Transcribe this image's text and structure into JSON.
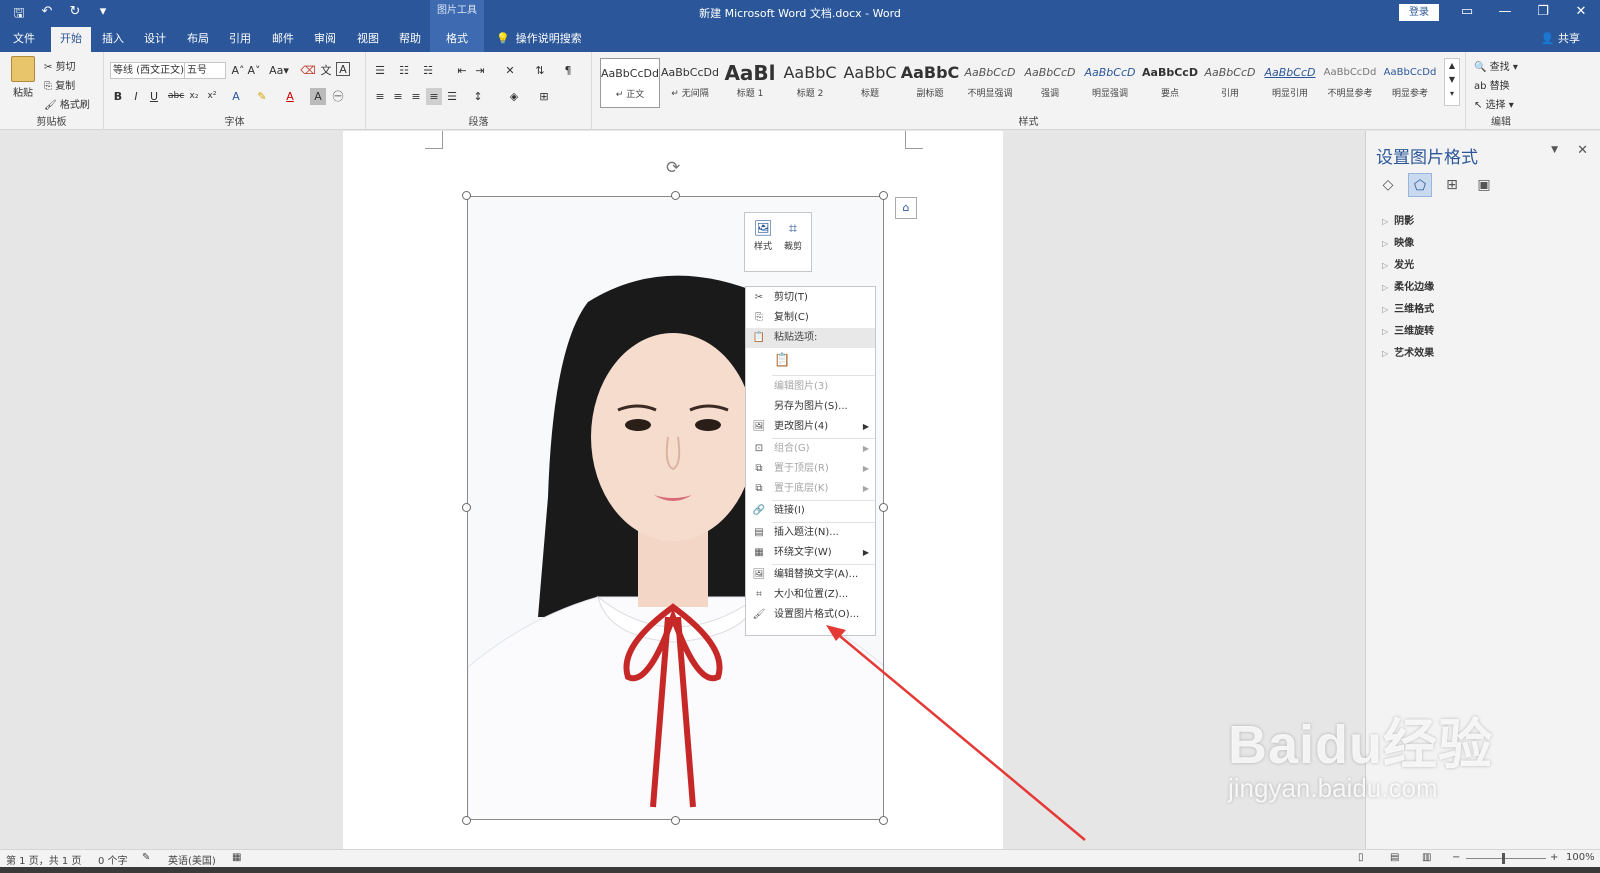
{
  "titlebar": {
    "context_tools": "图片工具",
    "document_title": "新建 Microsoft Word 文档.docx  -  Word",
    "login_label": "登录"
  },
  "tabs": {
    "file": "文件",
    "home": "开始",
    "insert": "插入",
    "design": "设计",
    "layout": "布局",
    "references": "引用",
    "mailings": "邮件",
    "review": "审阅",
    "view": "视图",
    "help": "帮助",
    "format": "格式",
    "tell_me": "操作说明搜索",
    "share": "共享"
  },
  "ribbon": {
    "clipboard": {
      "label": "剪贴板",
      "paste": "粘贴",
      "cut": "剪切",
      "copy": "复制",
      "format_painter": "格式刷"
    },
    "font": {
      "label": "字体",
      "font_name": "等线 (西文正文)",
      "font_size": "五号"
    },
    "paragraph": {
      "label": "段落"
    },
    "styles": {
      "label": "样式",
      "items": [
        {
          "preview": "AaBbCcDd",
          "name": "↵ 正文"
        },
        {
          "preview": "AaBbCcDd",
          "name": "↵ 无间隔"
        },
        {
          "preview": "AaBl",
          "name": "标题 1"
        },
        {
          "preview": "AaBbC",
          "name": "标题 2"
        },
        {
          "preview": "AaBbC",
          "name": "标题"
        },
        {
          "preview": "AaBbC",
          "name": "副标题"
        },
        {
          "preview": "AaBbCcD",
          "name": "不明显强调"
        },
        {
          "preview": "AaBbCcD",
          "name": "强调"
        },
        {
          "preview": "AaBbCcD",
          "name": "明显强调"
        },
        {
          "preview": "AaBbCcD",
          "name": "要点"
        },
        {
          "preview": "AaBbCcD",
          "name": "引用"
        },
        {
          "preview": "AaBbCcD",
          "name": "明显引用"
        },
        {
          "preview": "AaBbCcDd",
          "name": "不明显参考"
        },
        {
          "preview": "AaBbCcDd",
          "name": "明显参考"
        }
      ]
    },
    "editing": {
      "label": "编辑",
      "find": "查找",
      "replace": "替换",
      "select": "选择"
    }
  },
  "mini_toolbar": {
    "style": "样式",
    "crop": "裁剪"
  },
  "context_menu": {
    "cut": "剪切(T)",
    "copy": "复制(C)",
    "paste_options": "粘贴选项:",
    "edit_picture": "编辑图片(3)",
    "save_as_picture": "另存为图片(S)...",
    "change_picture": "更改图片(4)",
    "group": "组合(G)",
    "bring_to_front": "置于顶层(R)",
    "send_to_back": "置于底层(K)",
    "link": "链接(I)",
    "insert_caption": "插入题注(N)...",
    "wrap_text": "环绕文字(W)",
    "edit_alt_text": "编辑替换文字(A)...",
    "size_position": "大小和位置(Z)...",
    "format_picture": "设置图片格式(O)..."
  },
  "pane": {
    "title": "设置图片格式",
    "sections": [
      "阴影",
      "映像",
      "发光",
      "柔化边缘",
      "三维格式",
      "三维旋转",
      "艺术效果"
    ]
  },
  "statusbar": {
    "page": "第 1 页，共 1 页",
    "words": "0 个字",
    "language": "英语(美国)",
    "zoom": "100%"
  },
  "watermark": {
    "main": "Baidu经验",
    "sub": "jingyan.baidu.com"
  },
  "colors": {
    "accent": "#2b579a",
    "arrow": "#e53935"
  }
}
